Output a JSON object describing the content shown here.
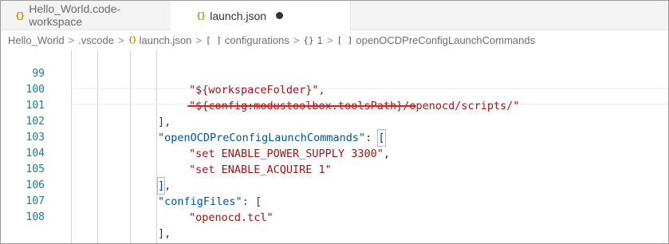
{
  "tabs": [
    {
      "icon": "{}",
      "label": "Hello_World.code-workspace"
    },
    {
      "icon": "{}",
      "label": "launch.json"
    }
  ],
  "breadcrumb": {
    "items": [
      "Hello_World",
      ".vscode",
      "launch.json",
      "configurations",
      "1",
      "openOCDPreConfigLaunchCommands"
    ],
    "icons": [
      "",
      "",
      "{}",
      "[ ]",
      "{}",
      "[ ]"
    ]
  },
  "lines": [
    {
      "num": "99",
      "text": "\"${workspaceFolder}\","
    },
    {
      "num": "100",
      "text": "\"${config:modustoolbox.toolsPath}/openocd/scripts/\""
    },
    {
      "num": "101",
      "text": "],"
    },
    {
      "num": "102",
      "key": "\"openOCDPreConfigLaunchCommands\"",
      "rest": ": ",
      "bracket": "["
    },
    {
      "num": "103",
      "text": "\"set ENABLE_POWER_SUPPLY 3300\"",
      "rest": ","
    },
    {
      "num": "104",
      "text": "\"set ENABLE_ACQUIRE 1\""
    },
    {
      "num": "105",
      "bracket": "]",
      "rest": ","
    },
    {
      "num": "106",
      "key": "\"configFiles\"",
      "rest": ": ",
      "bracket": "["
    },
    {
      "num": "107",
      "text": "\"openocd.tcl\""
    },
    {
      "num": "108",
      "text": "],"
    }
  ]
}
